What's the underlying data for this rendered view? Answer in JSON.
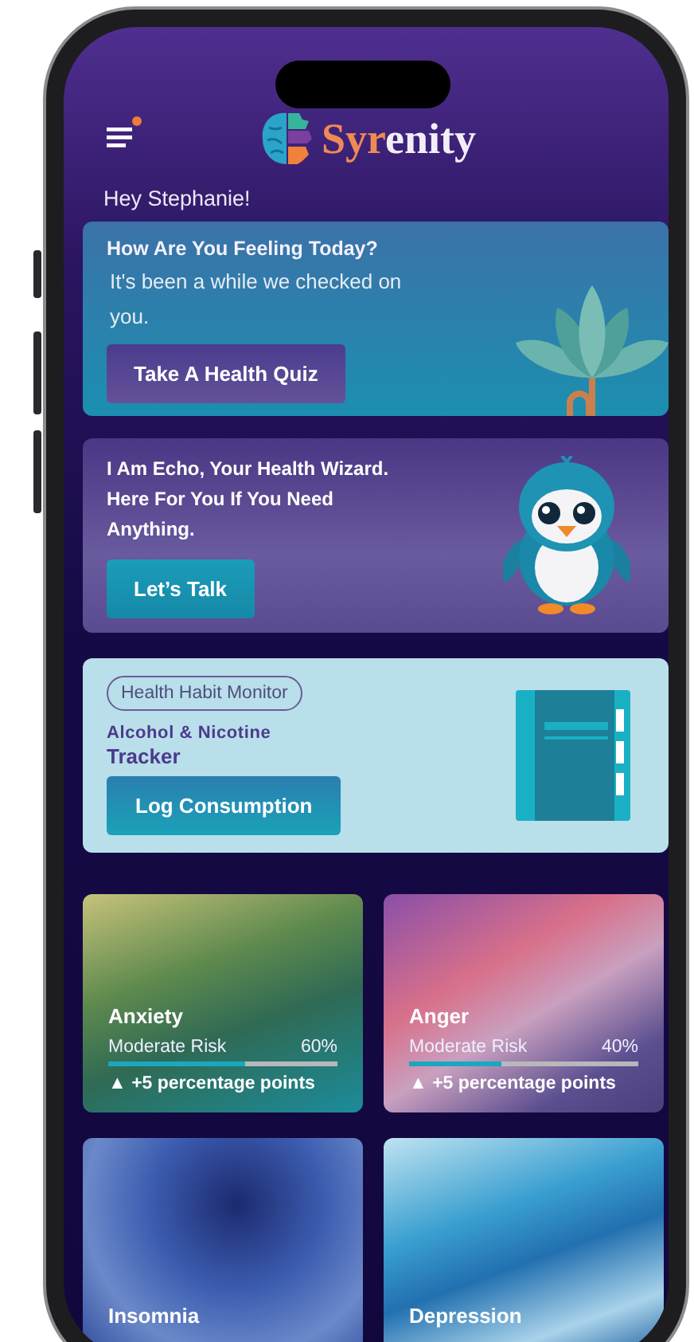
{
  "header": {
    "has_notification": true,
    "brand": {
      "highlight": "Syr",
      "rest": "enity"
    }
  },
  "greeting": "Hey Stephanie!",
  "quiz_card": {
    "title": "How Are You Feeling Today?",
    "text": "It's been a while we checked on you.",
    "button": "Take A Health Quiz"
  },
  "echo_card": {
    "text": "I Am Echo, Your Health Wizard. Here For You If You Need Anything.",
    "button": "Let’s Talk"
  },
  "tracker_card": {
    "tag": "Health Habit Monitor",
    "subtitle": "Alcohol & Nicotine",
    "title": "Tracker",
    "button": "Log Consumption"
  },
  "conditions": [
    {
      "name": "Anxiety",
      "risk": "Moderate Risk",
      "percent": "60%",
      "level": 0.6,
      "change": "▲ +5 percentage points"
    },
    {
      "name": "Anger",
      "risk": "Moderate Risk",
      "percent": "40%",
      "level": 0.4,
      "change": "▲ +5 percentage points"
    },
    {
      "name": "Insomnia"
    },
    {
      "name": "Depression"
    }
  ]
}
